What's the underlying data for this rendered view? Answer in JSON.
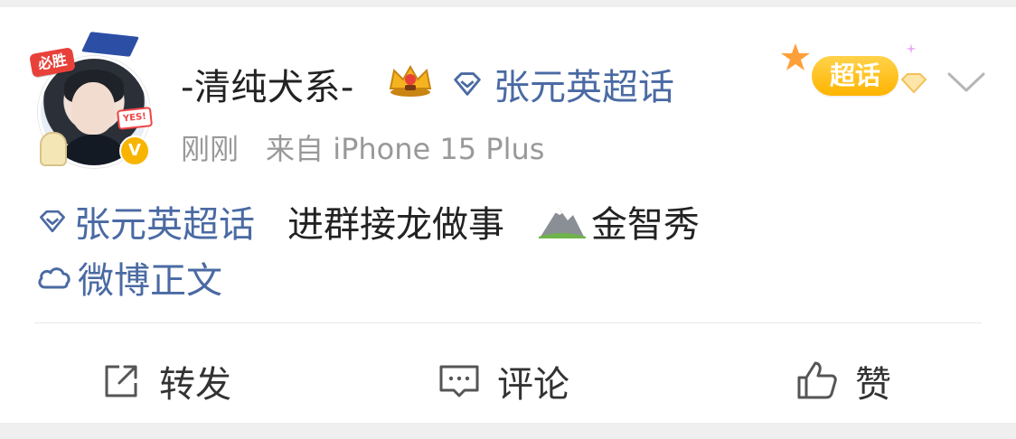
{
  "post": {
    "author": {
      "name": "-清纯犬系-",
      "avatar_badge": "必胜",
      "avatar_tag": "YES!",
      "verified_badge": "V"
    },
    "header_topic": "张元英超话",
    "time": "刚刚",
    "source": "来自 iPhone 15 Plus",
    "chaohua_badge": "超话",
    "content": {
      "topic_tag": "张元英超话",
      "text": "进群接龙做事",
      "mention_name": "金智秀",
      "source_link": "微博正文"
    }
  },
  "actions": {
    "share_label": "转发",
    "comment_label": "评论",
    "like_label": "赞"
  },
  "icons": {
    "crown": "crown-icon",
    "topic": "diamond-icon",
    "mention": "mountain-icon",
    "source": "cloud-icon",
    "share": "share-icon",
    "comment": "comment-icon",
    "like": "thumbs-up-icon",
    "more": "chevron-down-icon"
  },
  "colors": {
    "link_blue": "#4a6aa3",
    "meta_gray": "#999999",
    "chaohua_yellow": "#ffb400",
    "page_bg": "#efefef"
  }
}
